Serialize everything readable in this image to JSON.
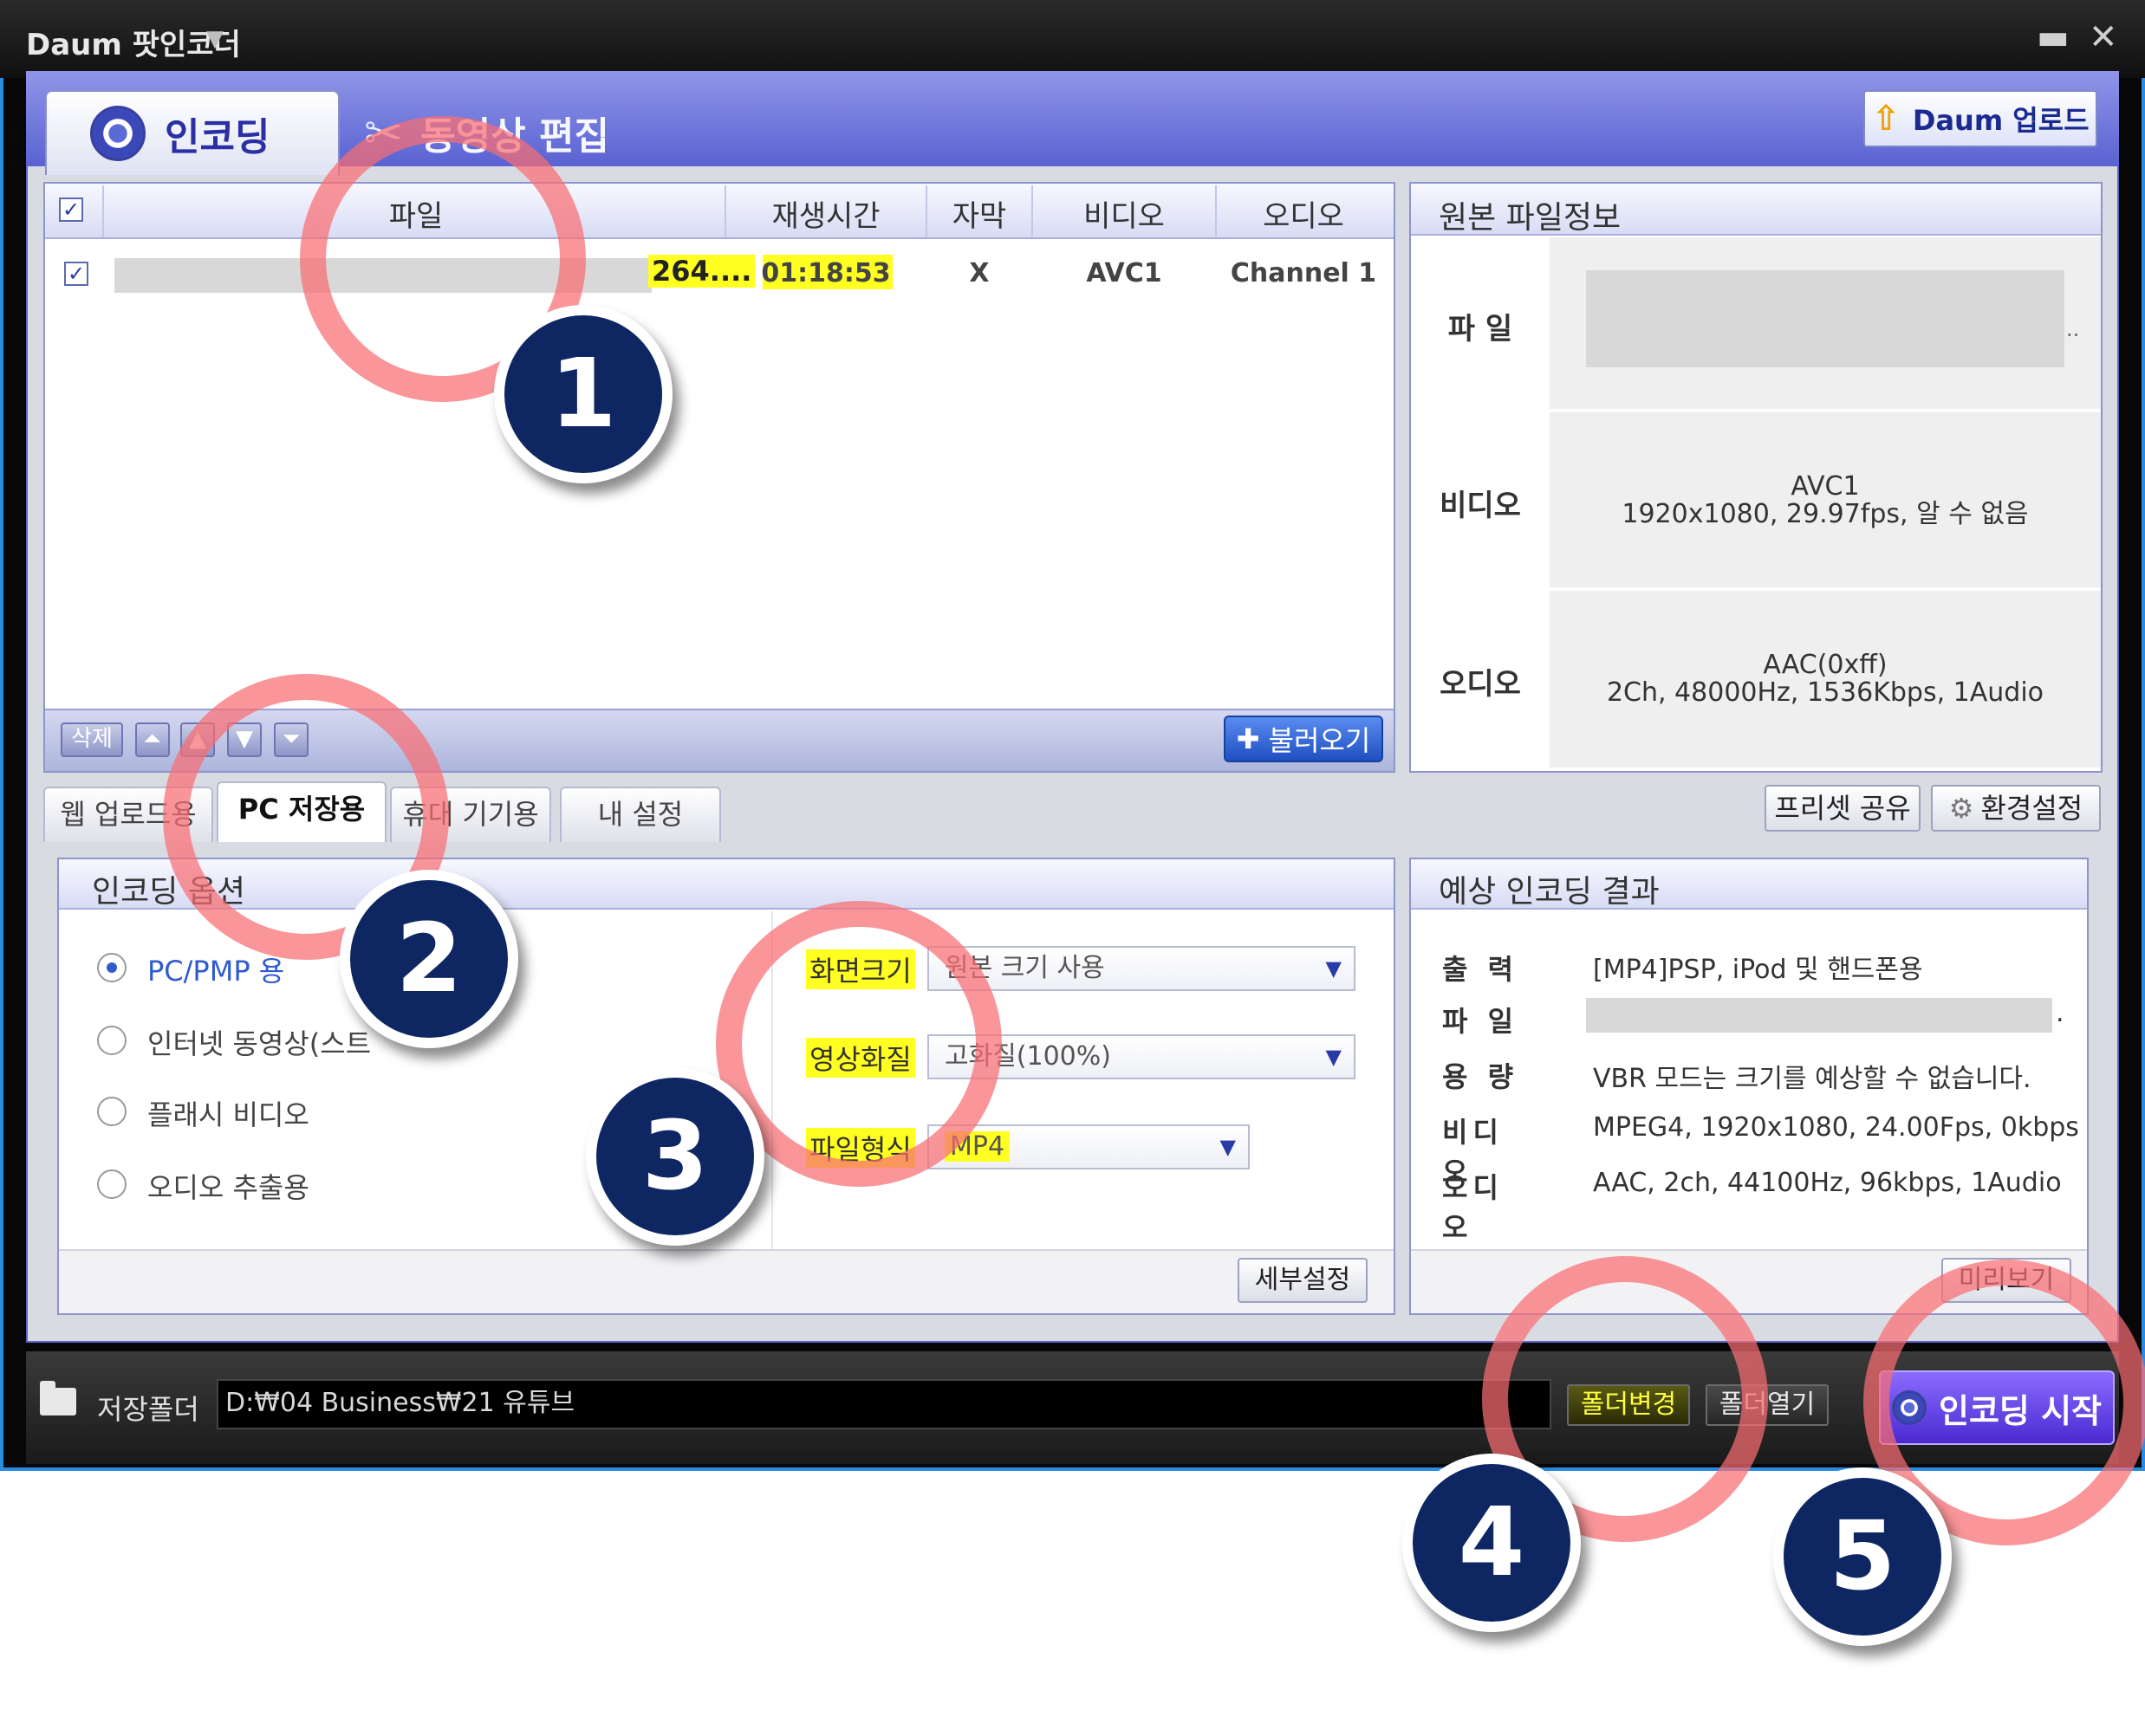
{
  "window": {
    "title": "Daum 팟인코더",
    "minimize": "▬",
    "close": "✕"
  },
  "main_tabs": [
    {
      "label": "인코딩"
    },
    {
      "label": "동영상 편집"
    }
  ],
  "upload_button": "Daum 업로드",
  "file_table": {
    "columns": [
      "파일",
      "재생시간",
      "자막",
      "비디오",
      "오디오"
    ],
    "header_checked": true,
    "rows": [
      {
        "checked": true,
        "file": "264....",
        "duration": "01:18:53",
        "subtitle": "X",
        "video": "AVC1",
        "audio": "Channel 1"
      }
    ]
  },
  "list_toolbar": {
    "delete": "삭제",
    "top": "⏶",
    "up": "▲",
    "down": "▼",
    "bottom": "⏷",
    "load": "불러오기"
  },
  "original_info": {
    "title": "원본 파일정보",
    "file_label": "파 일",
    "file_suffix": "..",
    "video_label": "비디오",
    "video_codec": "AVC1",
    "video_detail": "1920x1080, 29.97fps, 알 수 없음",
    "audio_label": "오디오",
    "audio_codec": "AAC(0xff)",
    "audio_detail": "2Ch, 48000Hz, 1536Kbps, 1Audio"
  },
  "preset_tabs": [
    "웹 업로드용",
    "PC 저장용",
    "휴대 기기용",
    "내 설정"
  ],
  "preset_share": "프리셋 공유",
  "settings": "환경설정",
  "encoding_options": {
    "title": "인코딩 옵션",
    "radios": [
      {
        "label": "PC/PMP 용",
        "selected": true
      },
      {
        "label": "인터넷 동영상(스트",
        "selected": false
      },
      {
        "label": "플래시 비디오",
        "selected": false
      },
      {
        "label": "오디오 추출용",
        "selected": false
      }
    ],
    "screen_size_label": "화면크기",
    "screen_size_value": "원본 크기 사용",
    "quality_label": "영상화질",
    "quality_value": "고화질(100%)",
    "format_label": "파일형식",
    "format_value": "MP4",
    "detail_button": "세부설정"
  },
  "expected_result": {
    "title": "예상 인코딩 결과",
    "output_label": "출 력",
    "output_value": "[MP4]PSP, iPod 및 핸드폰용",
    "file_label": "파 일",
    "file_suffix": ".",
    "size_label": "용 량",
    "size_value": "VBR 모드는 크기를 예상할 수 없습니다.",
    "video_label": "비디오",
    "video_value": "MPEG4, 1920x1080, 24.00Fps, 0kbps",
    "audio_label": "오디오",
    "audio_value": "AAC, 2ch, 44100Hz, 96kbps, 1Audio",
    "preview_button": "미리보기"
  },
  "bottom": {
    "save_folder_label": "저장폴더",
    "path": "D:₩04 Business₩21 유튜브",
    "folder_change": "폴더변경",
    "folder_open": "폴더열기",
    "start": "인코딩 시작"
  },
  "annotations": [
    "1",
    "2",
    "3",
    "4",
    "5"
  ],
  "colors": {
    "highlight": "#ffff22",
    "ring": "#f86e73",
    "badge": "#0e2662",
    "accent": "#5a62d2"
  }
}
